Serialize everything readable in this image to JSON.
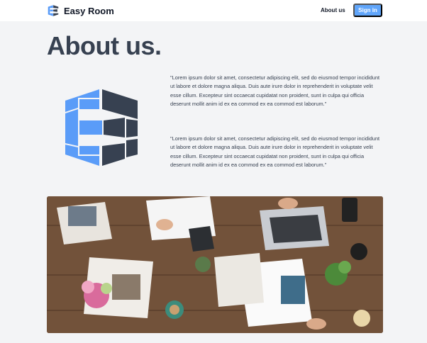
{
  "brand": {
    "name": "Easy Room",
    "icon": "easy-room-logo-icon"
  },
  "nav": {
    "about_label": "About us",
    "signin_label": "Sign in"
  },
  "page": {
    "title": "About us."
  },
  "content": {
    "paragraphs": [
      "\"Lorem ipsum dolor sit amet, consectetur adipiscing elit, sed do eiusmod tempor incididunt ut labore et dolore magna aliqua. Duis aute irure dolor in reprehenderit in voluptate velit esse cillum. Excepteur sint occaecat cupidatat non proident, sunt in culpa qui officia deserunt mollit anim id ex ea commod ex ea commod est laborum.\"",
      "\"Lorem ipsum dolor sit amet, consectetur adipiscing elit, sed do eiusmod tempor incididunt ut labore et dolore magna aliqua. Duis aute irure dolor in reprehenderit in voluptate velit esse cillum. Excepteur sint occaecat cupidatat non proident, sunt in culpa qui officia deserunt mollit anim id ex ea commod ex ea commod est laborum.\""
    ]
  },
  "colors": {
    "accent": "#60a5fa",
    "logo_blue": "#5a9cf8",
    "logo_dark": "#374151",
    "background": "#f3f4f6"
  }
}
